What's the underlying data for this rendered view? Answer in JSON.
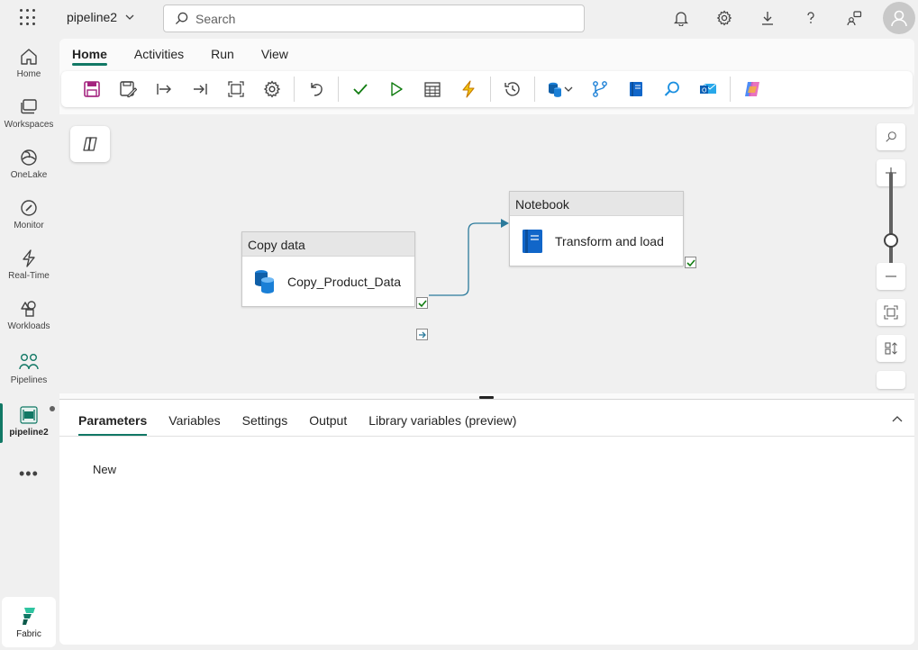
{
  "header": {
    "app_title": "pipeline2",
    "search_placeholder": "Search"
  },
  "rail": {
    "items": [
      {
        "label": "Home"
      },
      {
        "label": "Workspaces"
      },
      {
        "label": "OneLake"
      },
      {
        "label": "Monitor"
      },
      {
        "label": "Real-Time"
      },
      {
        "label": "Workloads"
      },
      {
        "label": "Pipelines"
      },
      {
        "label": "pipeline2"
      }
    ],
    "more": "•••",
    "footer_label": "Fabric"
  },
  "ribbon": {
    "tabs": [
      "Home",
      "Activities",
      "Run",
      "View"
    ],
    "active_tab": "Home"
  },
  "canvas": {
    "activities": [
      {
        "type": "Copy data",
        "name": "Copy_Product_Data"
      },
      {
        "type": "Notebook",
        "name": "Transform and load"
      }
    ]
  },
  "bottom_panel": {
    "tabs": [
      "Parameters",
      "Variables",
      "Settings",
      "Output",
      "Library variables (preview)"
    ],
    "active_tab": "Parameters",
    "new_label": "New"
  },
  "colors": {
    "accent": "#117865",
    "connector": "#2b7a9b",
    "success": "#107c10"
  }
}
